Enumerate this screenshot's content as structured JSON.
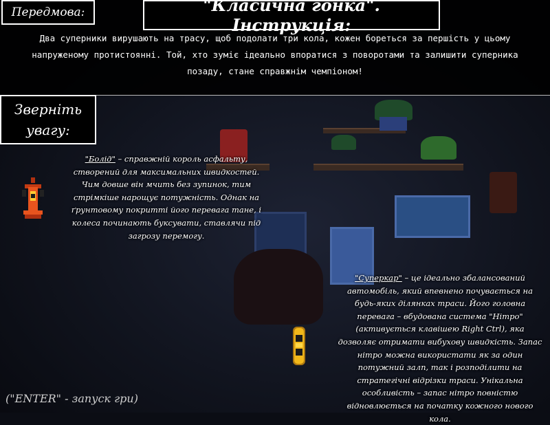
{
  "header": {
    "preface_label": "Передмова:",
    "title": "\"Класична гонка\". Інструкція:"
  },
  "intro": {
    "text": "Два суперники вирушають на трасу, щоб подолати три кола, кожен бореться за першість у цьому напруженому протистоянні. Той, хто зуміє ідеально впоратися з поворотами та залишити суперника позаду, стане справжнім чемпіоном!"
  },
  "attention": {
    "line1": "Зверніть",
    "line2": "увагу:"
  },
  "cars": {
    "bolid": {
      "name": "\"Болід\"",
      "text": " – справжній король асфальту, створений для максимальних швидкостей. Чим довше він мчить без зупинок, тим стрімкіше нарощує потужність. Однак на ґрунтовому покритті його перевага тане, і колеса починають буксувати, ставлячи під загрозу перемогу.",
      "color": "#e8541e"
    },
    "supercar": {
      "name": "\"Суперкар\"",
      "text": " – це ідеально збалансований автомобіль, який впевнено почувається на будь-яких ділянках траси. Його головна перевага – вбудована система \"Нітро\" (активується клавішею Right Ctrl), яка дозволяє отримати вибухову швидкість. Запас нітро можна використати як за один потужний залп, так і розподілити на стратегічні відрізки траси. Унікальна особливість – запас нітро повністю відновлюється на початку кожного нового кола.",
      "color": "#f2b81a"
    }
  },
  "footer": {
    "hint": "(\"ENTER\" - запуск гри)"
  }
}
